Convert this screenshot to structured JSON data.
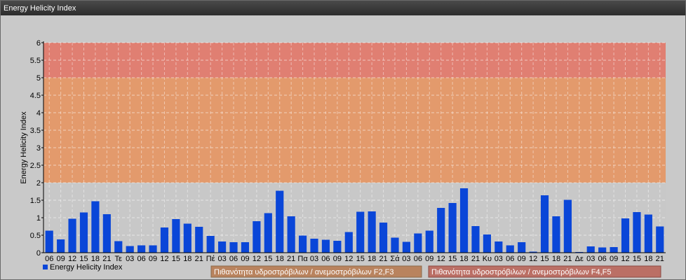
{
  "window": {
    "title": "Energy Helicity Index"
  },
  "chart_data": {
    "type": "bar",
    "ylabel": "Energy Helicity Index",
    "ylim": [
      0,
      6
    ],
    "yticks": [
      "0",
      "0.5",
      "1",
      "1.5",
      "2",
      "2.5",
      "3",
      "3.5",
      "4",
      "4.5",
      "5",
      "5.5",
      "6"
    ],
    "grid": true,
    "categories": [
      "06",
      "09",
      "12",
      "15",
      "18",
      "21",
      "Τε",
      "03",
      "06",
      "09",
      "12",
      "15",
      "18",
      "21",
      "Πέ",
      "03",
      "06",
      "09",
      "12",
      "15",
      "18",
      "21",
      "Πα",
      "03",
      "06",
      "09",
      "12",
      "15",
      "18",
      "21",
      "Σά",
      "03",
      "06",
      "09",
      "12",
      "15",
      "18",
      "21",
      "Κυ",
      "03",
      "06",
      "09",
      "12",
      "15",
      "18",
      "21",
      "Δε",
      "03",
      "06",
      "09",
      "12",
      "15",
      "18",
      "21"
    ],
    "series": [
      {
        "name": "Energy Helicity Index",
        "color": "#0a46d8",
        "values": [
          0.63,
          0.38,
          0.97,
          1.15,
          1.47,
          1.1,
          0.33,
          0.19,
          0.21,
          0.21,
          0.72,
          0.96,
          0.83,
          0.74,
          0.48,
          0.32,
          0.3,
          0.3,
          0.9,
          1.13,
          1.77,
          1.04,
          0.49,
          0.4,
          0.37,
          0.34,
          0.59,
          1.17,
          1.18,
          0.86,
          0.43,
          0.31,
          0.55,
          0.63,
          1.28,
          1.42,
          1.84,
          0.76,
          0.52,
          0.32,
          0.21,
          0.3,
          0.03,
          1.64,
          1.04,
          1.51,
          0.02,
          0.18,
          0.15,
          0.16,
          0.98,
          1.16,
          1.09,
          0.75
        ]
      }
    ],
    "bands": [
      {
        "from": 0,
        "to": 2,
        "color": "#c8c8c8"
      },
      {
        "from": 2,
        "to": 5,
        "color": "#e39a6c",
        "label": "Πιθανότητα υδροστρόβιλων / ανεμοστρόβιλων F2,F3"
      },
      {
        "from": 5,
        "to": 6,
        "color": "#e07f72",
        "label": "Πιθανότητα υδροστρόβιλων / ανεμοστρόβιλων F4,F5"
      }
    ],
    "legend": "bottom-left"
  }
}
